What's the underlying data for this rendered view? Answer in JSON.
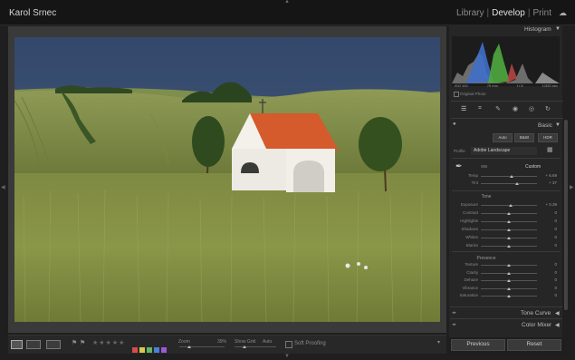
{
  "identity_plate": "Karol Srnec",
  "modules": [
    {
      "label": "Library",
      "active": false
    },
    {
      "label": "Develop",
      "active": true
    },
    {
      "label": "Print",
      "active": false
    }
  ],
  "histogram": {
    "title": "Histogram",
    "readout": [
      "ISO 100",
      "75 mm",
      "f / 8",
      "1/320 sec"
    ],
    "original_photo": "Original Photo"
  },
  "basic": {
    "title": "Basic",
    "treatment_buttons": [
      "Auto",
      "B&W",
      "HDR"
    ],
    "profile_label": "Profile",
    "profile_value": "Adobe Landscape",
    "wb_label": "WB",
    "wb_value": "Custom",
    "sliders_wb": [
      {
        "label": "Temp",
        "value": "+ 6.69",
        "pos": 0.55
      },
      {
        "label": "Tint",
        "value": "+ 37",
        "pos": 0.64
      }
    ],
    "tone_label": "Tone",
    "sliders_tone": [
      {
        "label": "Exposure",
        "value": "+ 0.39",
        "pos": 0.53
      },
      {
        "label": "Contrast",
        "value": "0",
        "pos": 0.5
      },
      {
        "label": "Highlights",
        "value": "0",
        "pos": 0.5
      },
      {
        "label": "Shadows",
        "value": "0",
        "pos": 0.5
      },
      {
        "label": "Whites",
        "value": "0",
        "pos": 0.5
      },
      {
        "label": "Blacks",
        "value": "0",
        "pos": 0.5
      }
    ],
    "presence_label": "Presence",
    "sliders_presence": [
      {
        "label": "Texture",
        "value": "0",
        "pos": 0.5
      },
      {
        "label": "Clarity",
        "value": "0",
        "pos": 0.5
      },
      {
        "label": "Dehaze",
        "value": "0",
        "pos": 0.5
      },
      {
        "label": "Vibrance",
        "value": "0",
        "pos": 0.5
      },
      {
        "label": "Saturation",
        "value": "0",
        "pos": 0.5
      }
    ]
  },
  "panels_collapsed": [
    "Tone Curve",
    "Color Mixer"
  ],
  "buttons": {
    "previous": "Previous",
    "reset": "Reset"
  },
  "toolbar": {
    "zoom_label": "Zoom",
    "zoom_value": "39%",
    "show_grid_label": "Show Grid",
    "show_grid_value": "Auto",
    "soft_proofing_label": "Soft Proofing",
    "color_labels": [
      "#d84c4c",
      "#d8c94c",
      "#5cb85c",
      "#4c7fd8",
      "#9b59d8"
    ]
  }
}
